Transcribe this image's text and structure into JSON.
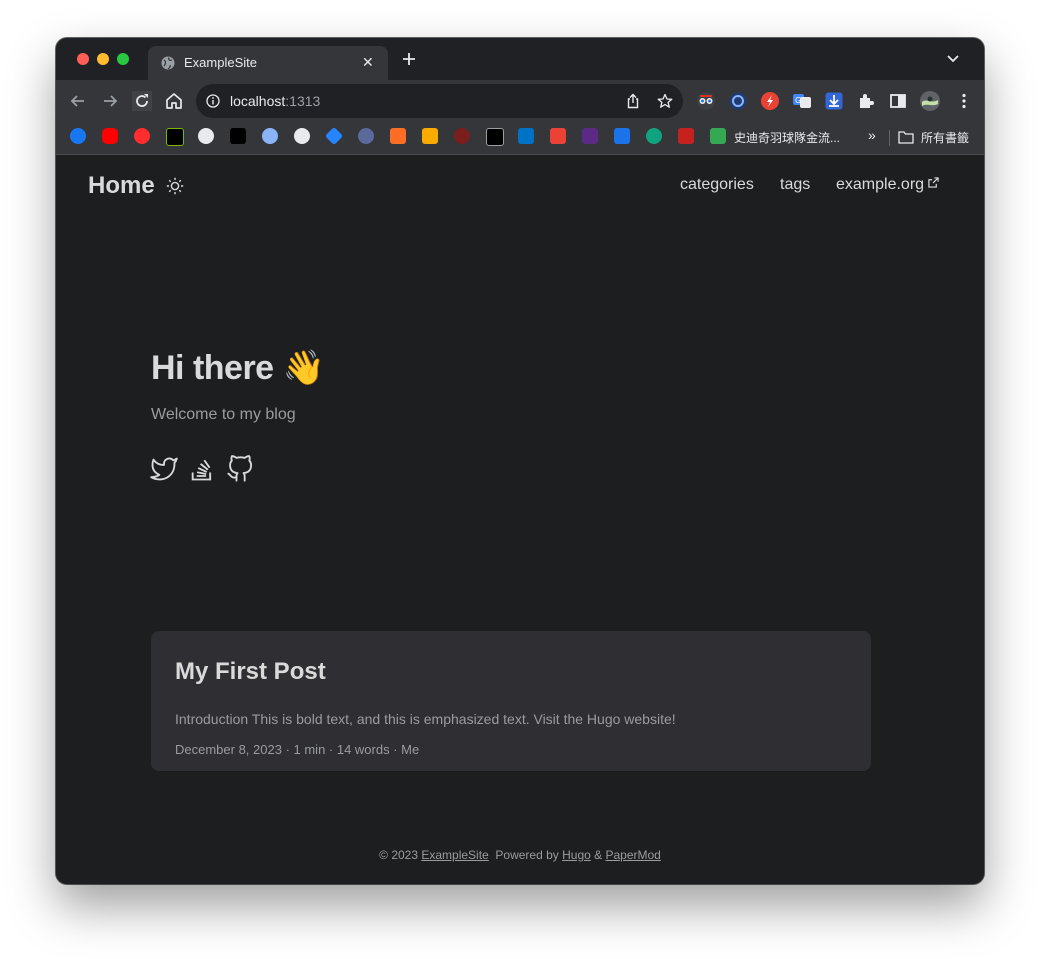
{
  "browser": {
    "tab_title": "ExampleSite",
    "tab_close_glyph": "✕",
    "url_host": "localhost",
    "url_port": ":1313",
    "bookmark_text_item": "史迪奇羽球隊金流...",
    "bookmark_overflow_glyph": "»",
    "bookmark_all_folder": "所有書籤",
    "traffic_colors": {
      "close": "#ff5f57",
      "minimize": "#febc2e",
      "zoom": "#28c840"
    }
  },
  "site": {
    "logo": "Home",
    "menu": [
      {
        "label": "categories"
      },
      {
        "label": "tags"
      },
      {
        "label": "example.org"
      }
    ]
  },
  "hero": {
    "title": "Hi there",
    "emoji": "👋",
    "subtitle": "Welcome to my blog",
    "social_icons": [
      "twitter-icon",
      "stackoverflow-icon",
      "github-icon"
    ]
  },
  "post": {
    "title": "My First Post",
    "summary": "Introduction This is bold text, and this is emphasized text. Visit the Hugo website!",
    "meta": "December 8, 2023 · 1 min · 14 words · Me"
  },
  "footer": {
    "copyright": "© 2023 ",
    "site_link": "ExampleSite",
    "powered_by": "  Powered by ",
    "hugo_link": "Hugo",
    "amp": " & ",
    "theme_link": "PaperMod"
  },
  "colors": {
    "page_bg": "#1d1e20",
    "card_bg": "#2e2e33",
    "primary_text": "#dadadb",
    "secondary_text": "#9b9c9d"
  }
}
